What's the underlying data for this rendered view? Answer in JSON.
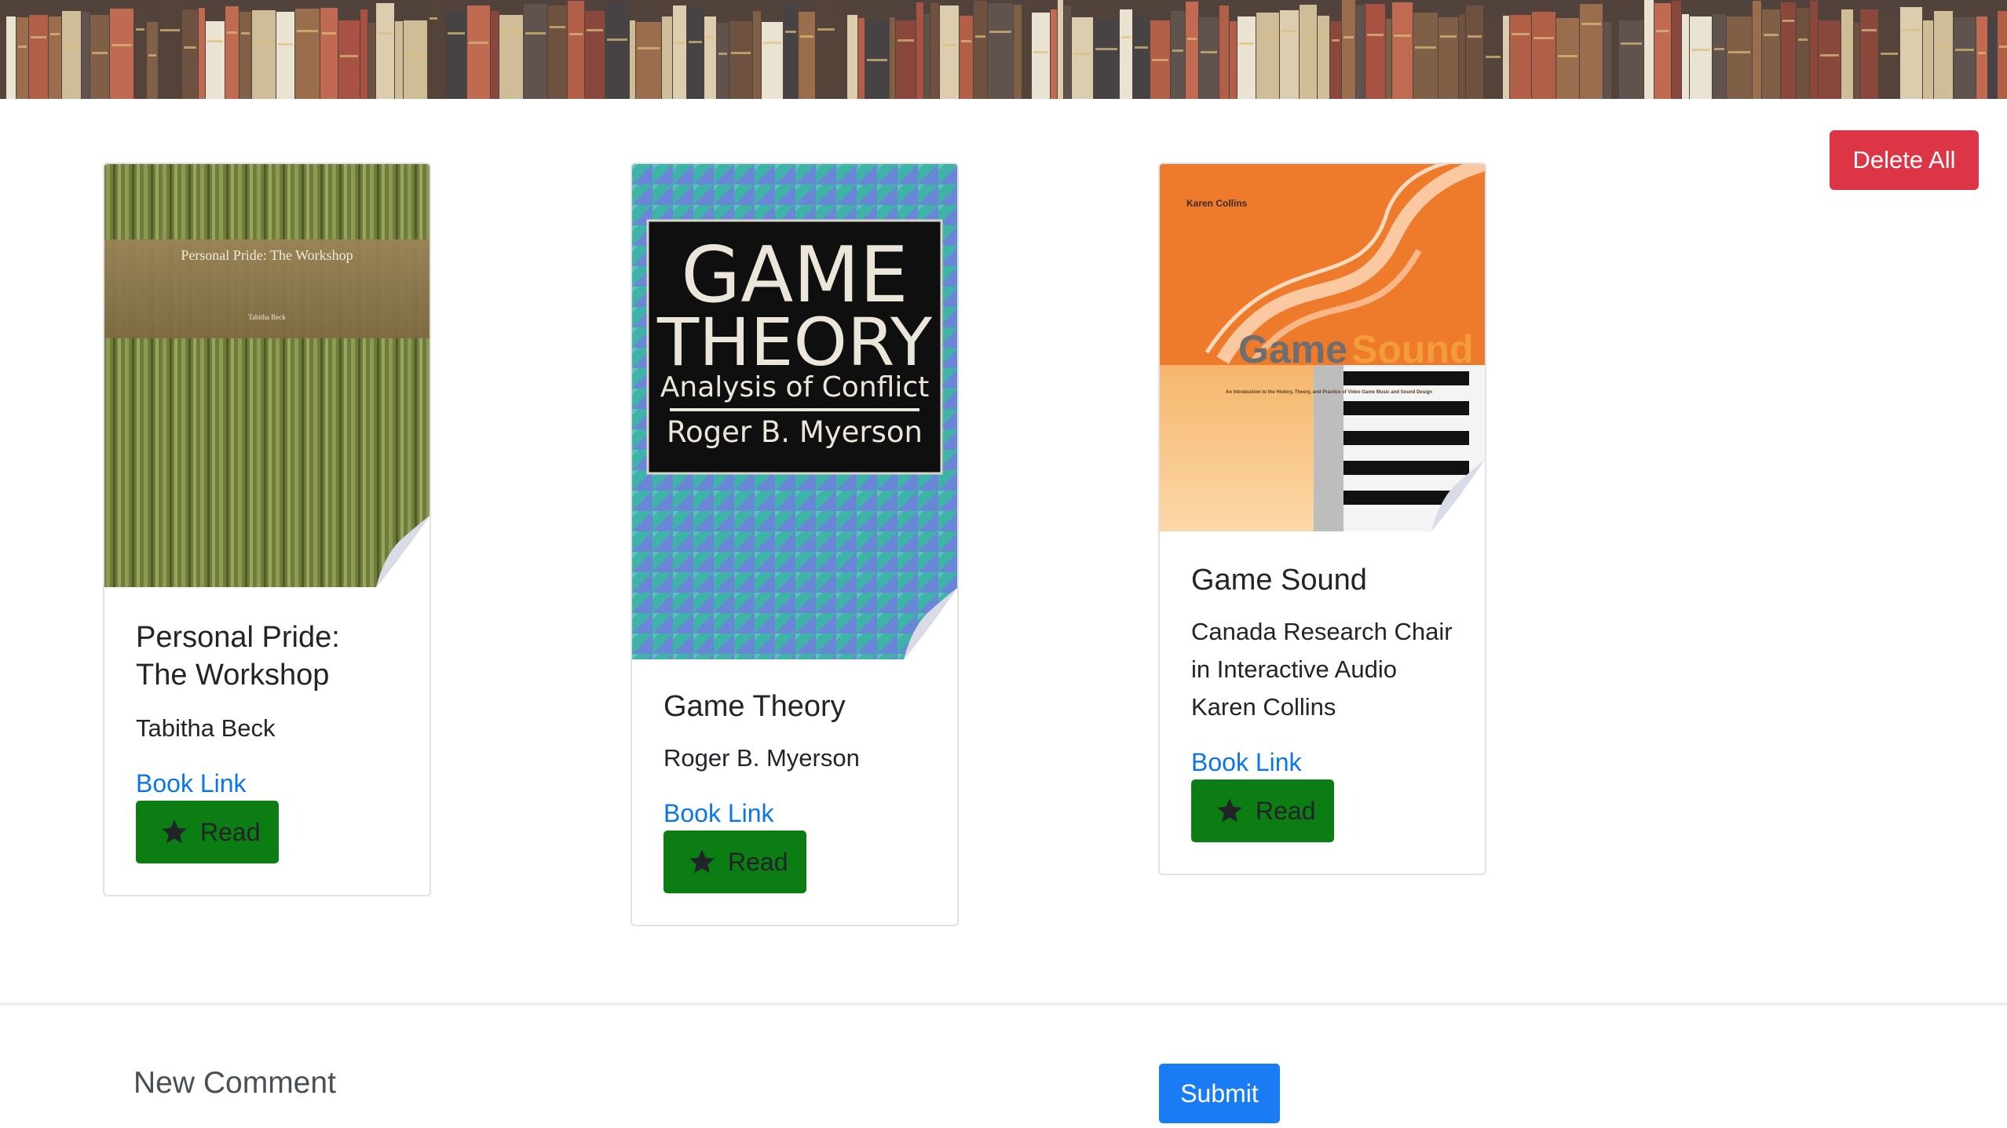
{
  "header": {
    "banner_image": "bookshelf-banner"
  },
  "toolbar": {
    "delete_all_label": "Delete All"
  },
  "books": [
    {
      "title": "Personal Pride: The Workshop",
      "author": "Tabitha Beck",
      "link_label": "Book Link",
      "read_label": "Read",
      "cover": {
        "title_text": "Personal Pride: The Workshop",
        "author_text": "Tabitha Beck"
      }
    },
    {
      "title": "Game Theory",
      "author": "Roger B. Myerson",
      "link_label": "Book Link",
      "read_label": "Read",
      "cover": {
        "line1": "GAME",
        "line2": "THEORY",
        "line3": "Analysis of Conflict",
        "line4": "Roger B. Myerson"
      }
    },
    {
      "title": "Game Sound",
      "author": "Canada Research Chair in Interactive Audio Karen Collins",
      "link_label": "Book Link",
      "read_label": "Read",
      "cover": {
        "author_text": "Karen Collins",
        "title_a": "Game",
        "title_b": "Sound",
        "subtitle": "An Introduction to the History, Theory, and Practice of Video Game Music and Sound Design"
      }
    }
  ],
  "comment": {
    "label": "New Comment",
    "submit_label": "Submit"
  },
  "colors": {
    "delete": "#dc3545",
    "read": "#0b7d12",
    "link": "#0d75ea",
    "submit": "#1a7cf4"
  }
}
